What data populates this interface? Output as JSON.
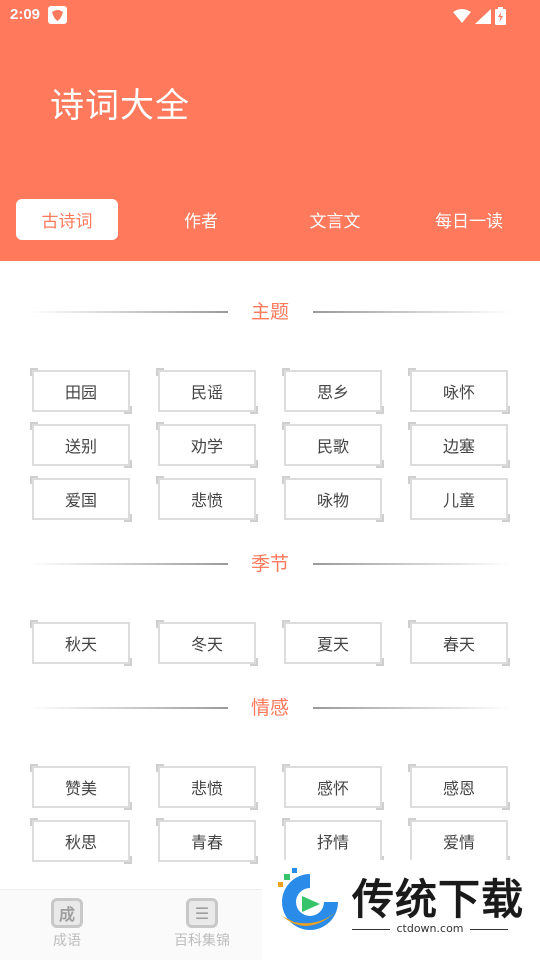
{
  "status": {
    "time": "2:09"
  },
  "header": {
    "title": "诗词大全"
  },
  "tabs": [
    {
      "label": "古诗词",
      "active": true
    },
    {
      "label": "作者",
      "active": false
    },
    {
      "label": "文言文",
      "active": false
    },
    {
      "label": "每日一读",
      "active": false
    }
  ],
  "sections": [
    {
      "title": "主题",
      "tags": [
        "田园",
        "民谣",
        "思乡",
        "咏怀",
        "送别",
        "劝学",
        "民歌",
        "边塞",
        "爱国",
        "悲愤",
        "咏物",
        "儿童"
      ]
    },
    {
      "title": "季节",
      "tags": [
        "秋天",
        "冬天",
        "夏天",
        "春天"
      ]
    },
    {
      "title": "情感",
      "tags": [
        "赞美",
        "悲愤",
        "感怀",
        "感恩",
        "秋思",
        "青春",
        "抒情",
        "爱情"
      ]
    }
  ],
  "bottom_nav": [
    {
      "label": "成语",
      "icon_glyph": "成",
      "icon": "idiom-icon"
    },
    {
      "label": "百科集锦",
      "icon_glyph": "☰",
      "icon": "encyclopedia-icon"
    }
  ],
  "watermark": {
    "brand": "传统下载",
    "url": "ctdown.com"
  },
  "colors": {
    "accent": "#ff7a5c",
    "tag_border": "#dcdcdc"
  }
}
